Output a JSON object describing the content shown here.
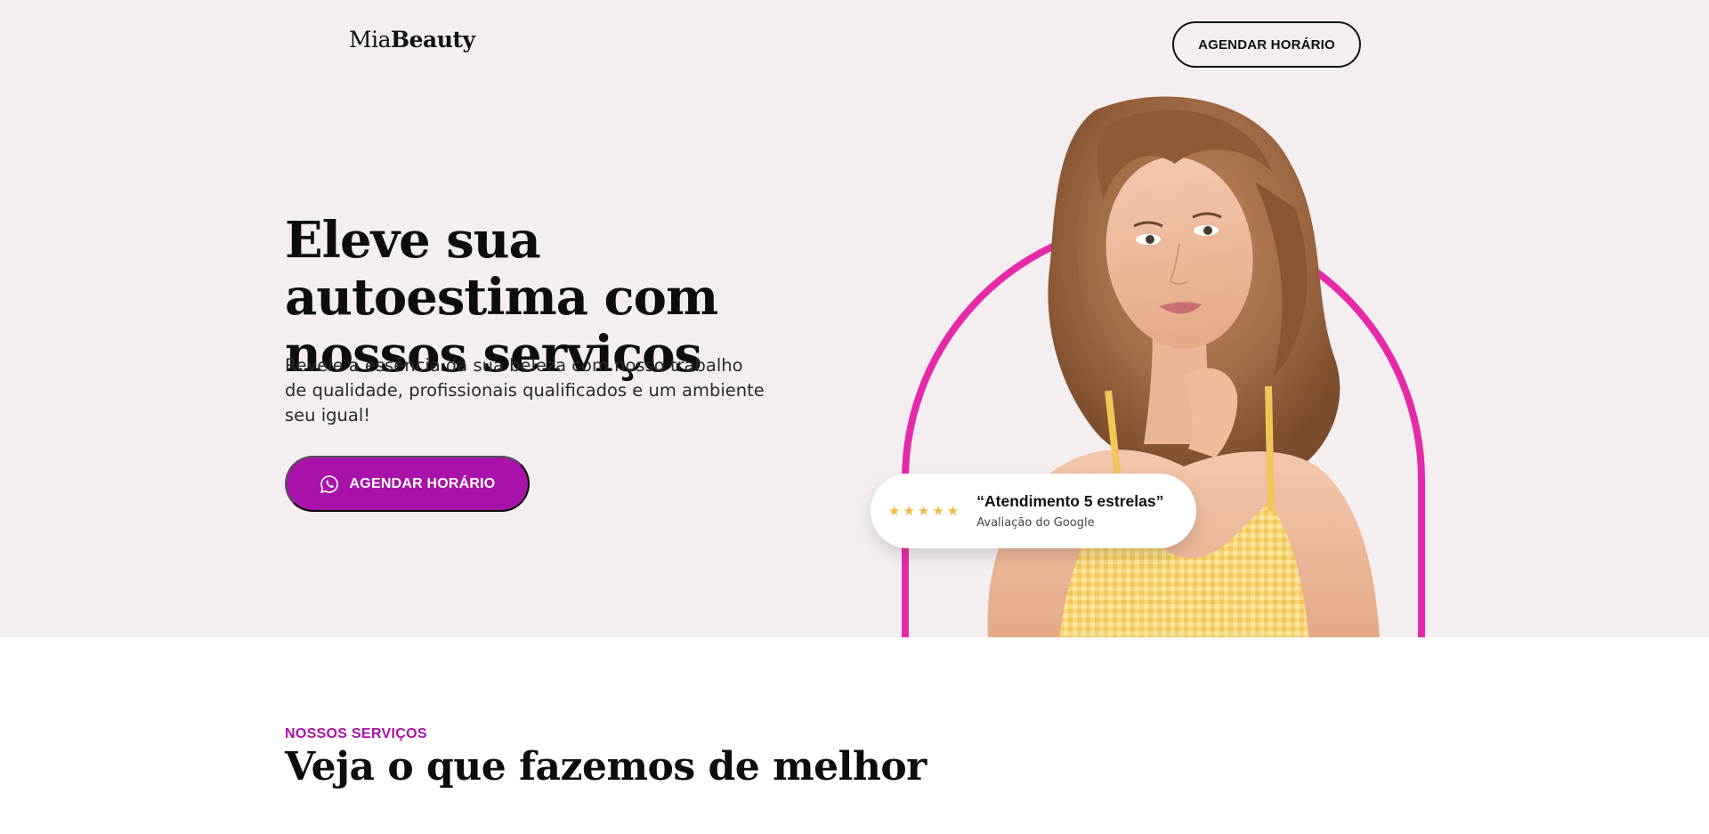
{
  "header": {
    "logo_part1": "Mia",
    "logo_part2": "Beauty",
    "cta_label": "AGENDAR HORÁRIO"
  },
  "hero": {
    "title": "Eleve sua autoestima com nossos serviços",
    "subtitle": "Revele a essência da sua beleza com nosso trabalho de qualidade, profissionais qualificados e um ambiente seu igual!",
    "cta_label": "AGENDAR HORÁRIO",
    "cta_icon": "whatsapp-icon",
    "review": {
      "stars": 5,
      "title": "“Atendimento 5 estrelas”",
      "source": "Avaliação do Google"
    }
  },
  "services": {
    "eyebrow": "NOSSOS SERVIÇOS",
    "title": "Veja o que fazemos de melhor"
  },
  "colors": {
    "hero_bg": "#f4eef0",
    "accent_purple": "#a812a8",
    "arch_pink": "#e52aa8",
    "star_gold": "#f5b942"
  }
}
